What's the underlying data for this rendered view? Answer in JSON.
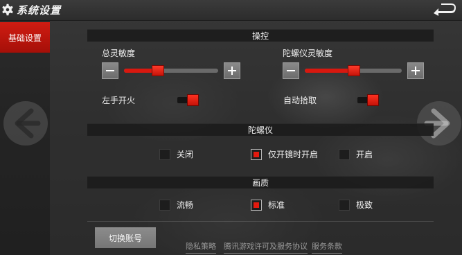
{
  "header": {
    "title": "系统设置",
    "icons": {
      "settings": "gear-icon",
      "back": "back-arrow-icon"
    }
  },
  "sidebar": {
    "items": [
      {
        "label": "基础设置",
        "active": true
      }
    ]
  },
  "nav": {
    "prev_icon": "arrow-left-icon",
    "next_icon": "arrow-right-icon"
  },
  "controls": {
    "header": "操控",
    "total_sensitivity": {
      "label": "总灵敏度",
      "value_fraction": 0.4,
      "minus_icon": "minus-icon",
      "plus_icon": "plus-icon"
    },
    "gyro_sensitivity": {
      "label": "陀螺仪灵敏度",
      "value_fraction": 0.5,
      "minus_icon": "minus-icon",
      "plus_icon": "plus-icon"
    },
    "left_fire": {
      "label": "左手开火",
      "on": true
    },
    "auto_pickup": {
      "label": "自动拾取",
      "on": true
    }
  },
  "gyroscope": {
    "header": "陀螺仪",
    "options": [
      {
        "label": "关闭",
        "checked": false
      },
      {
        "label": "仅开镜时开启",
        "checked": true
      },
      {
        "label": "开启",
        "checked": false
      }
    ]
  },
  "quality": {
    "header": "画质",
    "options": [
      {
        "label": "流畅",
        "checked": false
      },
      {
        "label": "标准",
        "checked": true
      },
      {
        "label": "极致",
        "checked": false
      }
    ]
  },
  "footer": {
    "switch_account": "切换账号",
    "links": [
      "隐私策略",
      "腾讯游戏许可及服务协议",
      "服务条款"
    ]
  },
  "colors": {
    "accent": "#d8180f",
    "panel": "#2a2a2a"
  }
}
